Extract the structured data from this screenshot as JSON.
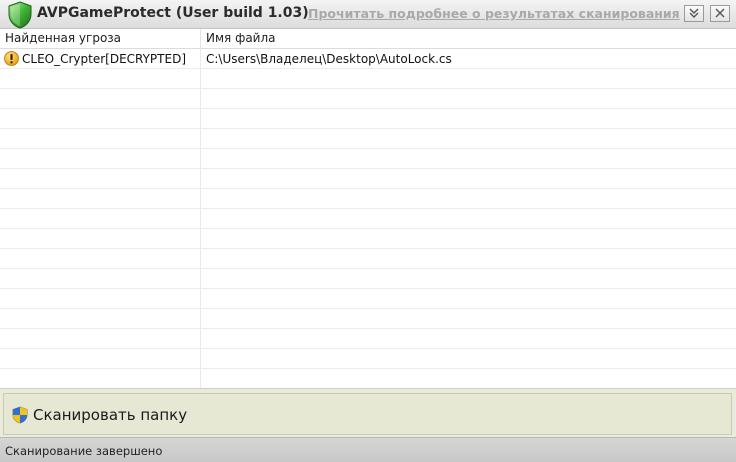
{
  "window": {
    "title": "AVPGameProtect (User build 1.03)",
    "details_link": "Прочитать подробнее о результатах сканирования",
    "accent": "#2e9d2a"
  },
  "grid": {
    "columns": [
      "Найденная угроза",
      "Имя файла"
    ],
    "rows": [
      {
        "threat": "CLEO_Crypter[DECRYPTED]",
        "file": "C:\\Users\\Владелец\\Desktop\\AutoLock.cs",
        "icon": "warning-icon"
      }
    ]
  },
  "actions": {
    "scan_folder_label": "Сканировать папку",
    "scan_folder_icon": "uac-shield-icon"
  },
  "status": {
    "text": "Сканирование завершено"
  }
}
